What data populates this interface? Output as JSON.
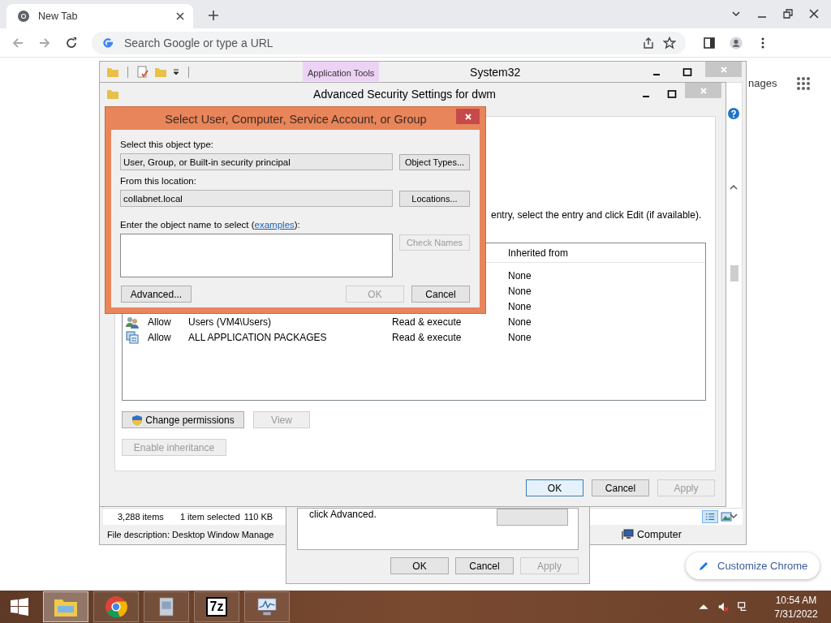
{
  "browser": {
    "tab_title": "New Tab",
    "omnibox_placeholder": "Search Google or type a URL",
    "page_link": "nages",
    "customize_button": "Customize Chrome"
  },
  "explorer": {
    "context_tab": "Application Tools",
    "title": "System32",
    "status_items": "3,288 items",
    "status_selected": "1 item selected",
    "status_size": "110 KB",
    "file_description": "File description: Desktop Window Manage",
    "location": "Computer"
  },
  "properties_dialog": {
    "text": "click Advanced.",
    "buttons": [
      {
        "label": "OK",
        "disabled": false
      },
      {
        "label": "Cancel",
        "disabled": false
      },
      {
        "label": "Apply",
        "disabled": true
      }
    ]
  },
  "advanced_security": {
    "title": "Advanced Security Settings for dwm",
    "instruction": "entry, select the entry and click Edit (if available).",
    "header_inherited_from": "Inherited from",
    "entries": [
      {
        "inherited_from": "None"
      },
      {
        "inherited_from": "None"
      },
      {
        "inherited_from": "None"
      },
      {
        "kind": "group",
        "type": "Allow",
        "principal": "Users (VM4\\Users)",
        "access": "Read & execute",
        "inherited_from": "None"
      },
      {
        "kind": "package",
        "type": "Allow",
        "principal": "ALL APPLICATION PACKAGES",
        "access": "Read & execute",
        "inherited_from": "None"
      }
    ],
    "actions": [
      {
        "kind": "uac",
        "label": "Change permissions",
        "disabled": false
      },
      {
        "kind": "plain",
        "label": "View",
        "disabled": true
      }
    ],
    "inheritance_button": {
      "label": "Enable inheritance",
      "disabled": true
    },
    "buttons": [
      {
        "label": "OK",
        "disabled": false,
        "default": true
      },
      {
        "label": "Cancel",
        "disabled": false,
        "default": false
      },
      {
        "label": "Apply",
        "disabled": true,
        "default": false
      }
    ]
  },
  "select_dialog": {
    "title": "Select User, Computer, Service Account, or Group",
    "object_type_label": "Select this object type:",
    "object_type_value": "User, Group, or Built-in security principal",
    "object_types_button": "Object Types...",
    "location_label": "From this location:",
    "location_value": "collabnet.local",
    "locations_button": "Locations...",
    "name_label": {
      "before": "Enter the object name to select (",
      "link": "examples",
      "after": "):"
    },
    "check_names": {
      "label": "Check Names",
      "disabled": true
    },
    "advanced_button": "Advanced...",
    "ok": {
      "label": "OK",
      "disabled": true
    },
    "cancel": {
      "label": "Cancel",
      "disabled": false
    }
  },
  "taskbar": {
    "apps": [
      {
        "kind": "explorer",
        "active": true
      },
      {
        "kind": "chrome",
        "active": false
      },
      {
        "kind": "installer",
        "active": false
      },
      {
        "kind": "archiver",
        "label": "7z",
        "active": false
      },
      {
        "kind": "monitor",
        "active": false
      }
    ],
    "time": "10:54 AM",
    "date": "7/31/2022"
  }
}
